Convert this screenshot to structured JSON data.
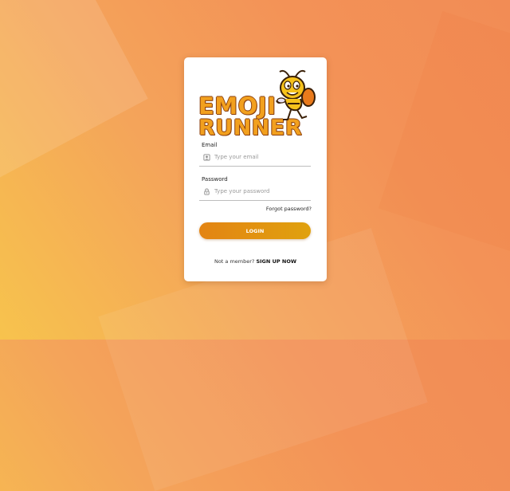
{
  "logo": {
    "line1": "EMOJI",
    "line2": "RUNNER"
  },
  "form": {
    "email_label": "Email",
    "email_placeholder": "Type your email",
    "email_value": "",
    "password_label": "Password",
    "password_placeholder": "Type your password",
    "password_value": "",
    "forgot_label": "Forgot password?",
    "login_label": "LOGIN",
    "member_text": "Not a member?",
    "signup_label": "SIGN UP NOW"
  },
  "icons": {
    "email": "user-card-icon",
    "password": "lock-icon"
  },
  "colors": {
    "background_start": "#f7c34d",
    "background_end": "#f28c55",
    "button_start": "#e38413",
    "button_end": "#e0a10e",
    "logo_fill": "#f2a01e",
    "logo_outline": "#8a3f0f"
  }
}
